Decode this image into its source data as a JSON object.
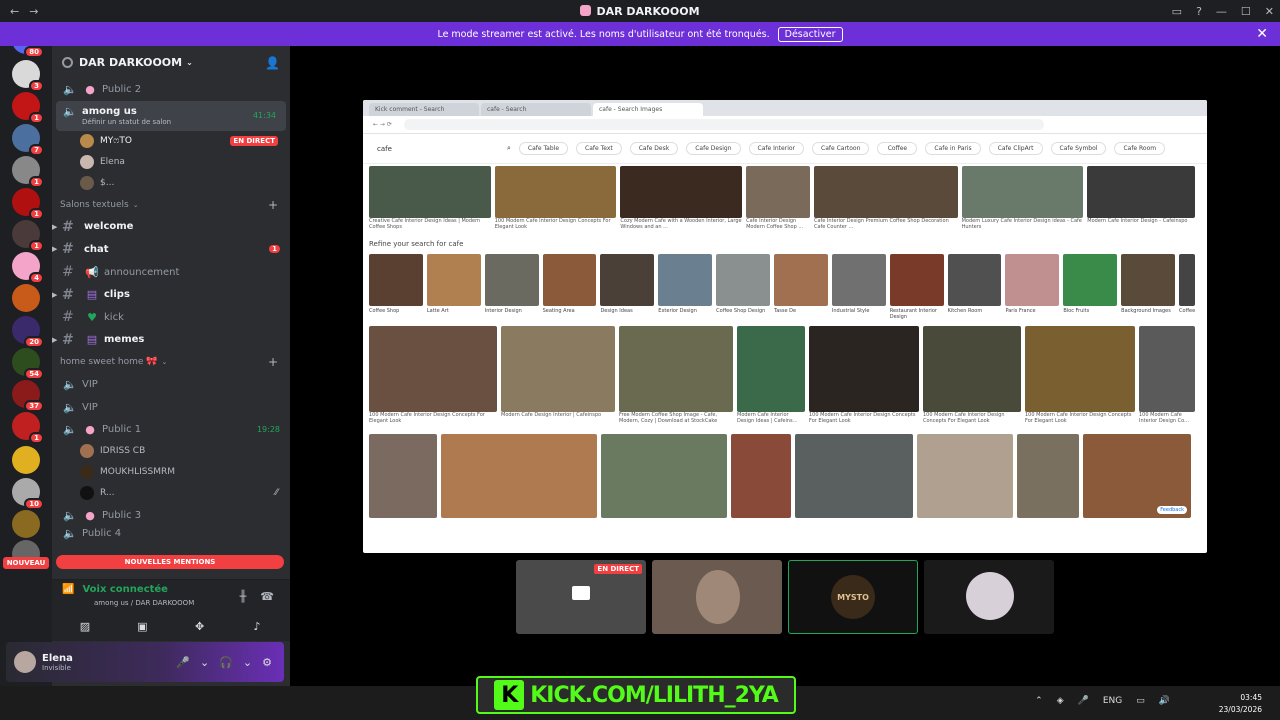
{
  "window": {
    "title": "DAR DARKOOOM",
    "back": "←",
    "forward": "→"
  },
  "banner": {
    "message": "Le mode streamer est activé. Les noms d'utilisateur ont été tronqués.",
    "button": "Désactiver",
    "close": "✕"
  },
  "servers": {
    "badges": [
      "80",
      "3",
      "1",
      "7",
      "1",
      "1",
      "1",
      "4",
      "2",
      "",
      "20",
      "54",
      "37",
      "1",
      "",
      "10",
      "",
      ""
    ],
    "nouveau": "NOUVEAU"
  },
  "guild": {
    "name": "DAR DARKOOOM"
  },
  "channels": {
    "public2": "Public 2",
    "among_us": {
      "name": "among us",
      "time": "41:34",
      "status": "Définir un statut de salon"
    },
    "voice_users": [
      {
        "name": "MYෆTO",
        "live": "EN DIRECT"
      },
      {
        "name": "Elena"
      },
      {
        "name": "$..."
      }
    ],
    "salons_textuels": "Salons textuels",
    "text": [
      {
        "name": "welcome"
      },
      {
        "name": "chat",
        "unread": "1"
      },
      {
        "name": "announcement"
      },
      {
        "name": "clips"
      },
      {
        "name": "kick"
      },
      {
        "name": "memes"
      }
    ],
    "home_cat": "home sweet home 🎀",
    "vip1": "VIP",
    "vip2": "VIP",
    "public1": {
      "name": "Public 1",
      "time": "19:28"
    },
    "public1_users": [
      "IDRISS CB",
      "MOUKHLISSMRM",
      "R..."
    ],
    "public3": "Public 3",
    "public4": "Public 4",
    "new_mentions": "NOUVELLES MENTIONS"
  },
  "voice": {
    "status": "Voix connectée",
    "location": "among us / DAR DARKOOOM"
  },
  "user": {
    "name": "Elena",
    "status": "Invisible"
  },
  "browser": {
    "tabs": [
      "Kick comment - Search",
      "cafe - Search",
      "cafe - Search Images"
    ],
    "query": "cafe",
    "chips": [
      "Cafe Table",
      "Cafe Text",
      "Cafe Desk",
      "Cafe Design",
      "Cafe Interior",
      "Cafe Cartoon",
      "Coffee",
      "Cafe in Paris",
      "Cafe ClipArt",
      "Cafe Symbol",
      "Cafe Room"
    ],
    "row1_captions": [
      "Creative Cafe Interior Design Ideas | Modern Coffee Shops",
      "100 Modern Cafe Interior Design Concepts For Elegant Look",
      "Cozy Modern Cafe with a Wooden Interior, Large Windows and an ...",
      "Cafe Interior Design Modern Coffee Shop ...",
      "Cafe Interior Design Premium Coffee Shop Decoration Cafe Counter ...",
      "Modern Luxury Cafe Interior Design ideas - Cafe Hunters",
      "Modern Cafe Interior Design - Cafeinspo"
    ],
    "refine": "Refine your search for cafe",
    "refine_tiles": [
      "Coffee Shop",
      "Latte Art",
      "Interior Design",
      "Seating Area",
      "Design Ideas",
      "Exterior Design",
      "Coffee Shop Design",
      "Tasse De",
      "Industrial Style",
      "Restaurant Interior Design",
      "Kitchen Room",
      "Paris France",
      "Bloc Fruits",
      "Background Images",
      "Coffee"
    ],
    "row3_captions": [
      "100 Modern Cafe Interior Design Concepts For Elegant Look",
      "Modern Cafe Design Interior | Cafeinspo",
      "Free Modern Coffee Shop Image - Cafe, Modern, Cozy | Download at StockCake",
      "Modern Cafe Interior Design Ideas | Cafeins...",
      "100 Modern Cafe Interior Design Concepts For Elegant Look",
      "100 Modern Cafe Interior Design Concepts For Elegant Look",
      "100 Modern Cafe Interior Design Concepts For Elegant Look",
      "100 Modern Cafe Interior Design Co..."
    ],
    "feedback": "Feedback"
  },
  "streams": {
    "live": "EN DIRECT",
    "mysto": "MYSTO"
  },
  "overlay": {
    "kick": "KICK.COM/LILITH_2YA",
    "k": "K"
  },
  "taskbar": {
    "lang": "ENG",
    "time": "03:45",
    "date": "23/03/2026"
  }
}
